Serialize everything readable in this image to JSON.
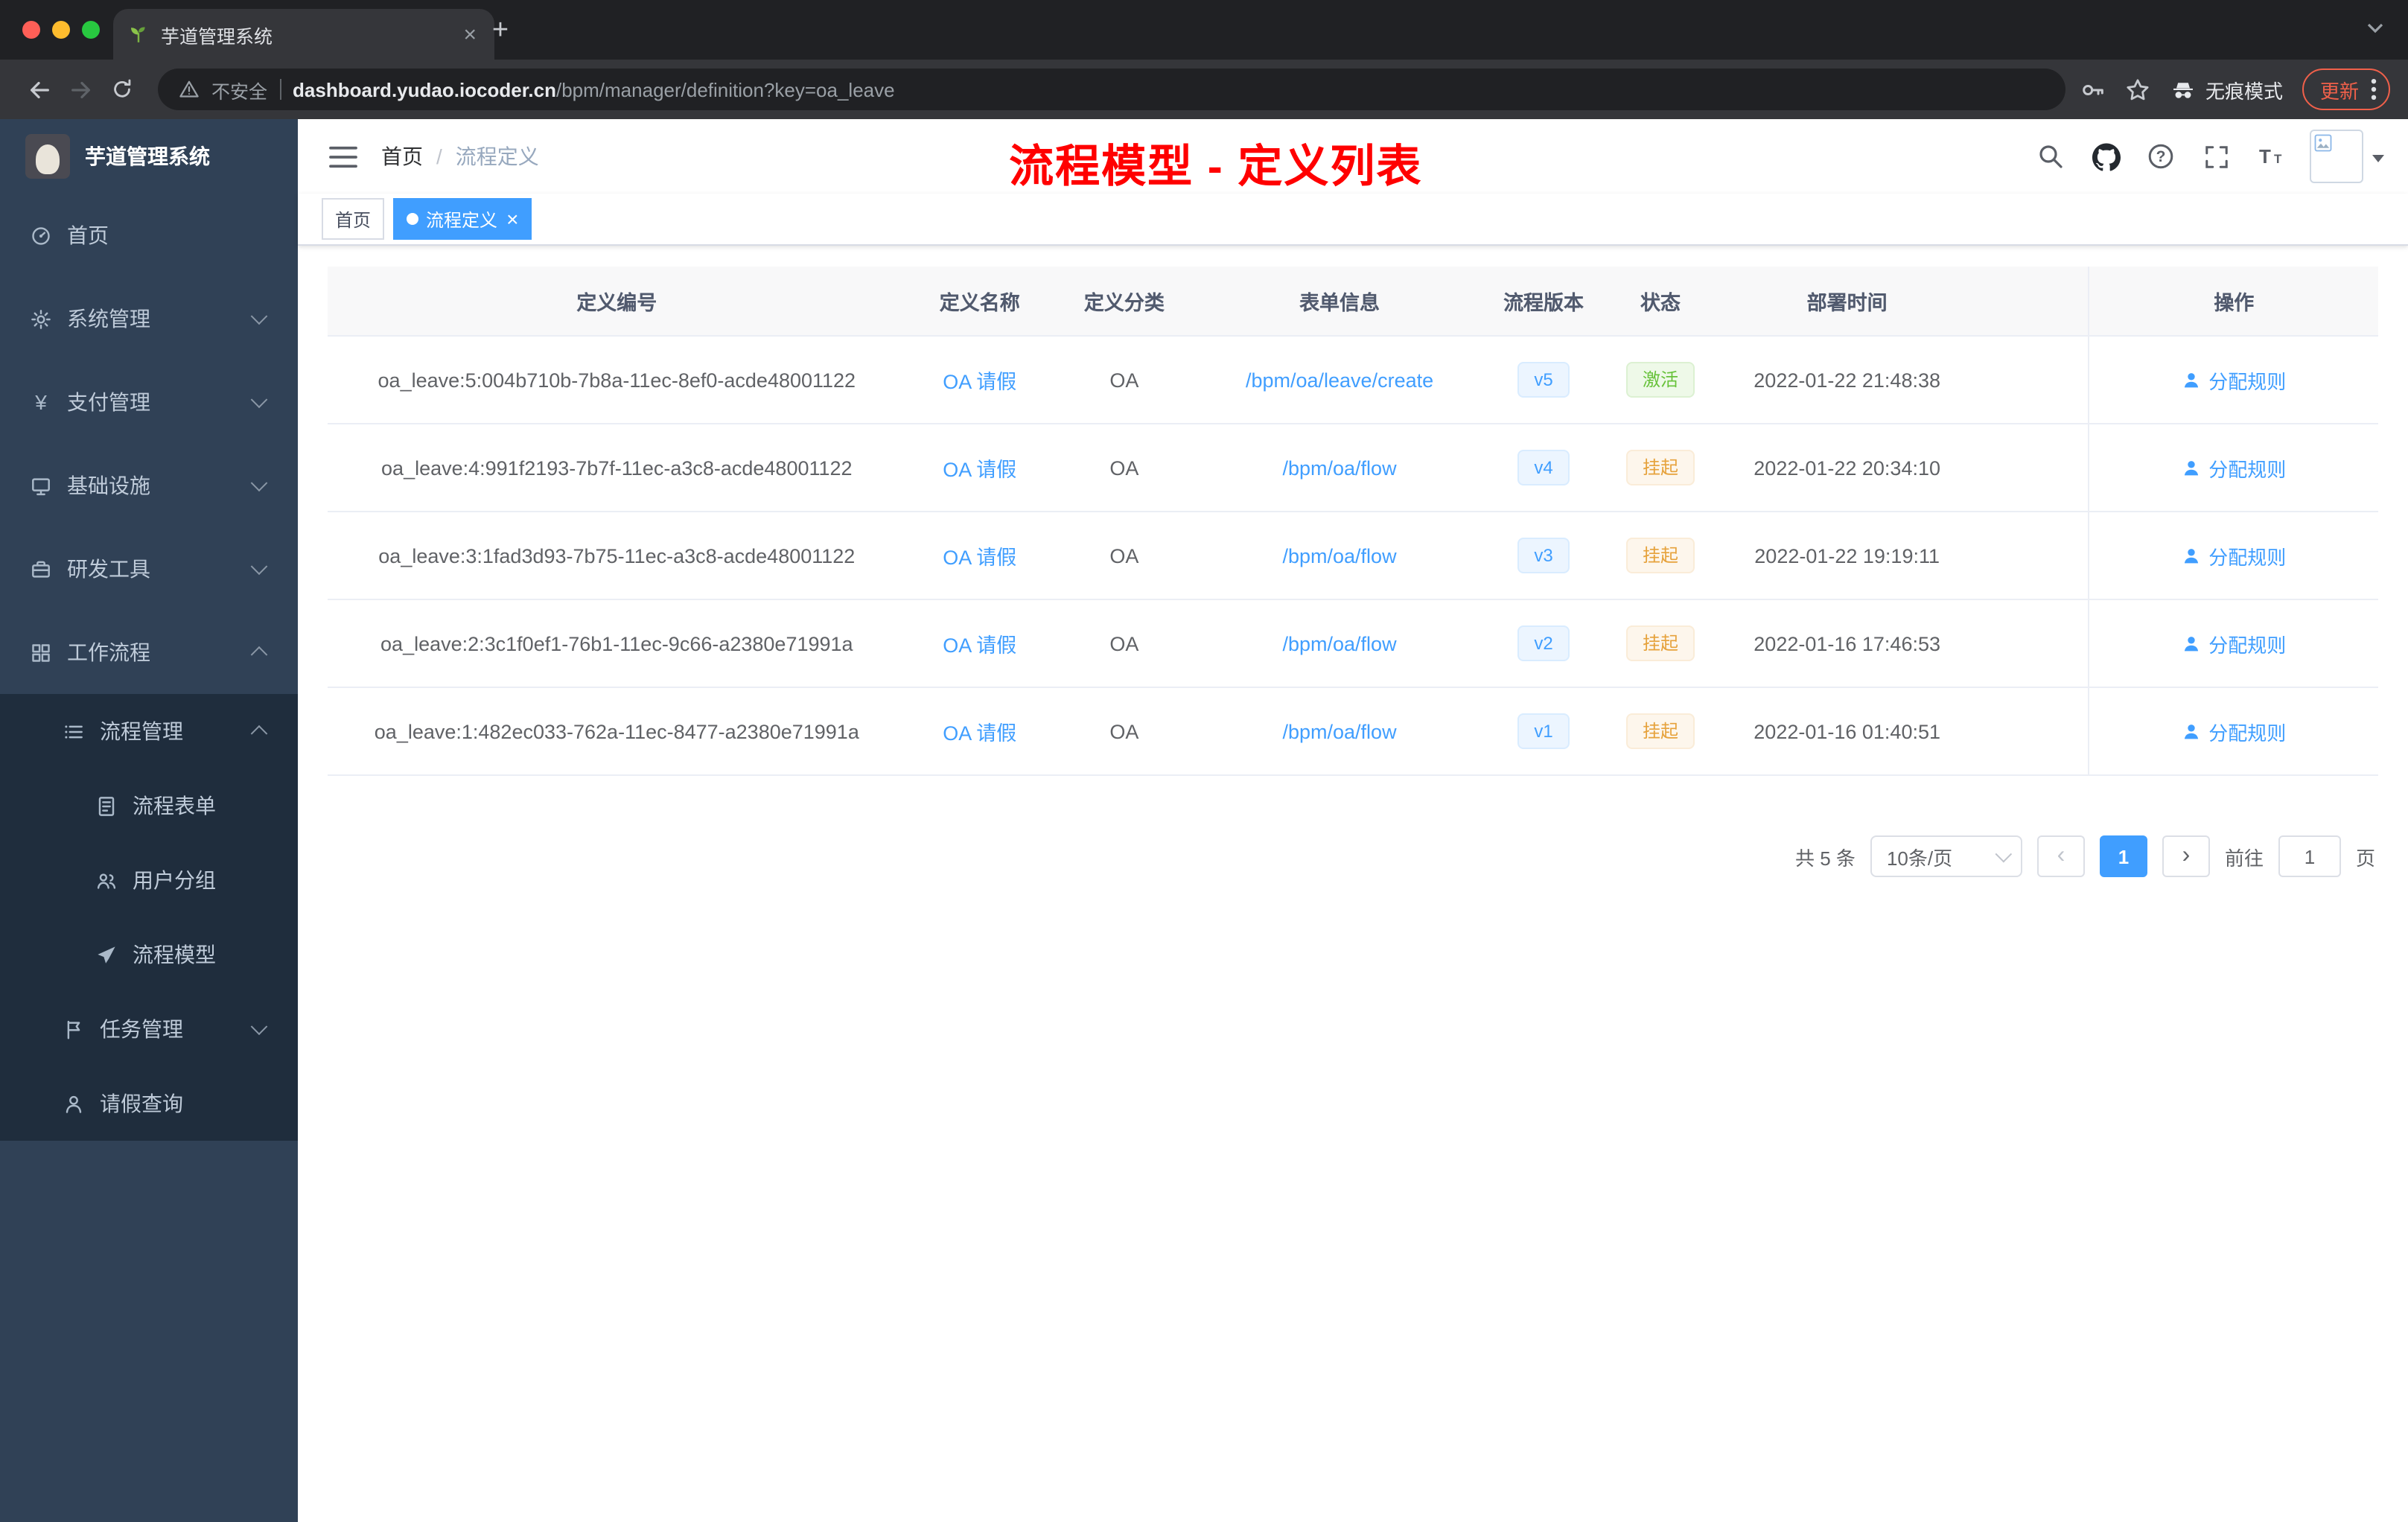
{
  "browser": {
    "tab_title": "芋道管理系统",
    "new_tab_label": "+",
    "security_label": "不安全",
    "url_host": "dashboard.yudao.iocoder.cn",
    "url_path": "/bpm/manager/definition?key=oa_leave",
    "incognito_label": "无痕模式",
    "update_label": "更新"
  },
  "colors": {
    "accent": "#409eff",
    "success": "#67c23a",
    "warning": "#e6a23c",
    "annotation": "#ff0000",
    "sidebar_bg": "#304156",
    "submenu_bg": "#1f2d3d"
  },
  "sidebar": {
    "logo_title": "芋道管理系统",
    "menu": [
      {
        "label": "首页",
        "icon": "home",
        "level": 1
      },
      {
        "label": "系统管理",
        "icon": "gear",
        "level": 1,
        "chevron": "down"
      },
      {
        "label": "支付管理",
        "icon": "yen",
        "level": 1,
        "chevron": "down"
      },
      {
        "label": "基础设施",
        "icon": "infra",
        "level": 1,
        "chevron": "down"
      },
      {
        "label": "研发工具",
        "icon": "tools",
        "level": 1,
        "chevron": "down"
      },
      {
        "label": "工作流程",
        "icon": "workflow",
        "level": 1,
        "chevron": "up"
      },
      {
        "label": "流程管理",
        "icon": "list",
        "level": 2,
        "chevron": "up",
        "sub": true
      },
      {
        "label": "流程表单",
        "icon": "form",
        "level": 3,
        "sub": true
      },
      {
        "label": "用户分组",
        "icon": "group",
        "level": 3,
        "sub": true
      },
      {
        "label": "流程模型",
        "icon": "model",
        "level": 3,
        "sub": true
      },
      {
        "label": "任务管理",
        "icon": "task",
        "level": 2,
        "chevron": "down",
        "sub": true
      },
      {
        "label": "请假查询",
        "icon": "user",
        "level": 2,
        "sub": true
      }
    ]
  },
  "header": {
    "breadcrumb": [
      "首页",
      "流程定义"
    ],
    "breadcrumb_separator": "/",
    "annotation": "流程模型 - 定义列表"
  },
  "tags": [
    {
      "label": "首页",
      "active": false,
      "closable": false
    },
    {
      "label": "流程定义",
      "active": true,
      "closable": true
    }
  ],
  "table": {
    "columns": [
      "定义编号",
      "定义名称",
      "定义分类",
      "表单信息",
      "流程版本",
      "状态",
      "部署时间",
      "操作"
    ],
    "rows": [
      {
        "id": "oa_leave:5:004b710b-7b8a-11ec-8ef0-acde48001122",
        "name": "OA 请假",
        "category": "OA",
        "form": "/bpm/oa/leave/create",
        "version": "v5",
        "status": "激活",
        "status_type": "success",
        "deploy_time": "2022-01-22 21:48:38",
        "action": "分配规则"
      },
      {
        "id": "oa_leave:4:991f2193-7b7f-11ec-a3c8-acde48001122",
        "name": "OA 请假",
        "category": "OA",
        "form": "/bpm/oa/flow",
        "version": "v4",
        "status": "挂起",
        "status_type": "warning",
        "deploy_time": "2022-01-22 20:34:10",
        "action": "分配规则"
      },
      {
        "id": "oa_leave:3:1fad3d93-7b75-11ec-a3c8-acde48001122",
        "name": "OA 请假",
        "category": "OA",
        "form": "/bpm/oa/flow",
        "version": "v3",
        "status": "挂起",
        "status_type": "warning",
        "deploy_time": "2022-01-22 19:19:11",
        "action": "分配规则"
      },
      {
        "id": "oa_leave:2:3c1f0ef1-76b1-11ec-9c66-a2380e71991a",
        "name": "OA 请假",
        "category": "OA",
        "form": "/bpm/oa/flow",
        "version": "v2",
        "status": "挂起",
        "status_type": "warning",
        "deploy_time": "2022-01-16 17:46:53",
        "action": "分配规则"
      },
      {
        "id": "oa_leave:1:482ec033-762a-11ec-8477-a2380e71991a",
        "name": "OA 请假",
        "category": "OA",
        "form": "/bpm/oa/flow",
        "version": "v1",
        "status": "挂起",
        "status_type": "warning",
        "deploy_time": "2022-01-16 01:40:51",
        "action": "分配规则"
      }
    ]
  },
  "pagination": {
    "total_label": "共 5 条",
    "page_size": "10条/页",
    "current_page": "1",
    "goto_label": "前往",
    "goto_value": "1",
    "page_suffix": "页"
  }
}
